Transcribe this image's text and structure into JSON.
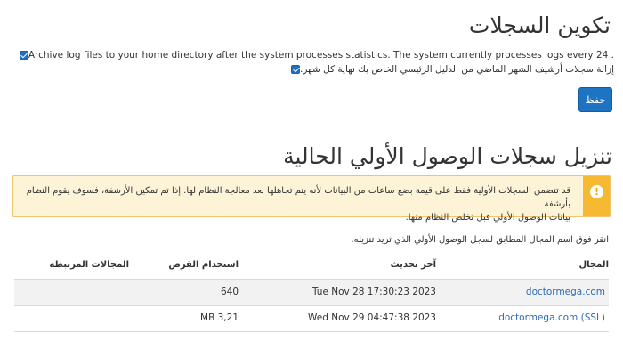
{
  "log_config": {
    "title": "تكوين السجلات",
    "archive_option": "Archive log files to your home directory after the system processes statistics. The system currently processes logs every 24 .",
    "remove_option": "إزالة سجلات أرشيف الشهر الماضي من الدليل الرئيسي الخاص بك نهاية كل شهر.",
    "archive_checked": true,
    "remove_checked": true,
    "save_label": "حفظ"
  },
  "raw_access": {
    "title": "تنزيل سجلات الوصول الأولي الحالية",
    "alert_line1": "قد تتضمن السجلات الأولية فقط على قيمة بضع ساعات من البيانات لأنه يتم تجاهلها بعد معالجة النظام لها. إذا تم تمكين الأرشفة، فسوف يقوم النظام بأرشفة",
    "alert_line2": "بيانات الوصول الأولي قبل تخلص النظام منها.",
    "alert_icon": "!",
    "hint": "انقر فوق اسم المجال المطابق لسجل الوصول الأولي الذي تريد تنزيله.",
    "columns": {
      "domain": "المجال",
      "last_update": "آخر تحديث",
      "disk_usage": "استخدام القرص",
      "related": "المجالات المرتبطة"
    },
    "rows": [
      {
        "domain": "doctormega.com",
        "last_update": "Tue Nov 28 17:30:23 2023",
        "disk_usage": "640",
        "related": ""
      },
      {
        "domain": "doctormega.com (SSL)",
        "last_update": "Wed Nov 29 04:47:38 2023",
        "disk_usage": "MB 3,21",
        "related": ""
      }
    ]
  }
}
